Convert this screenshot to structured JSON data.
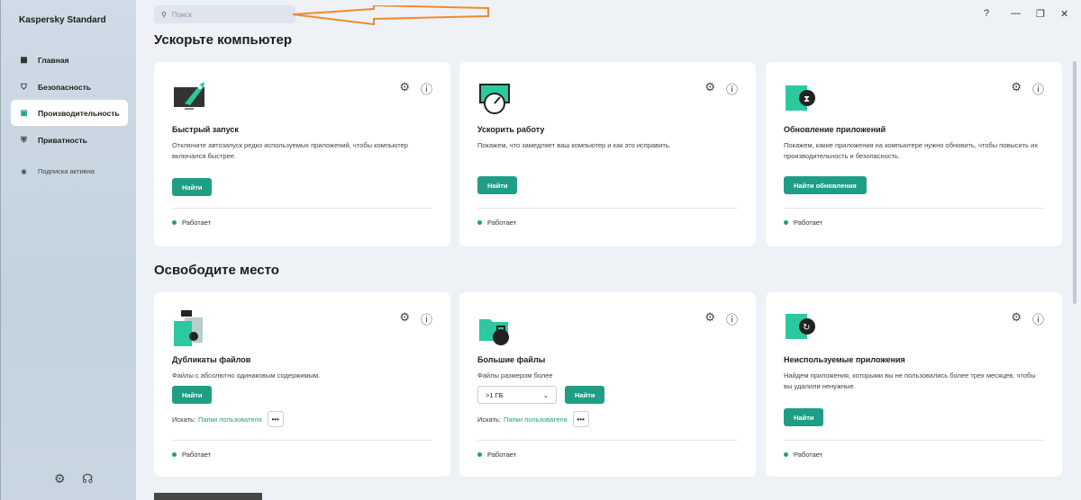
{
  "app": {
    "title": "Kaspersky Standard"
  },
  "sidebar": {
    "items": [
      {
        "label": "Главная"
      },
      {
        "label": "Безопасность"
      },
      {
        "label": "Производительность"
      },
      {
        "label": "Приватность"
      },
      {
        "label": "Подписка активна"
      }
    ]
  },
  "search": {
    "placeholder": "Поиск"
  },
  "window": {
    "help": "?",
    "minimize": "—",
    "restore": "❐",
    "close": "✕"
  },
  "sections": [
    {
      "title": "Ускорьте компьютер",
      "cards": [
        {
          "title": "Быстрый запуск",
          "desc": "Отключите автозапуск редко используемых приложений, чтобы компьютер включался быстрее.",
          "button": "Найти",
          "status": "Работает"
        },
        {
          "title": "Ускорить работу",
          "desc": "Покажем, что замедляет ваш компьютер и как это исправить.",
          "button": "Найти",
          "status": "Работает"
        },
        {
          "title": "Обновление приложений",
          "desc": "Покажем, какие приложения на компьютере нужно обновить, чтобы повысить их производительность и безопасность.",
          "button": "Найти обновления",
          "status": "Работает"
        }
      ]
    },
    {
      "title": "Освободите место",
      "cards": [
        {
          "title": "Дубликаты файлов",
          "desc": "Файлы с абсолютно одинаковым содержимым.",
          "button": "Найти",
          "search_label": "Искать:",
          "search_link": "Папки пользователя",
          "more": "•••",
          "status": "Работает"
        },
        {
          "title": "Большие файлы",
          "desc": "Файлы размером более",
          "select": ">1 ГБ",
          "button": "Найти",
          "search_label": "Искать:",
          "search_link": "Папки пользователя",
          "more": "•••",
          "status": "Работает"
        },
        {
          "title": "Неиспользуемые приложения",
          "desc": "Найдем приложения, которыми вы не пользовались более трех месяцев, чтобы вы удалили ненужные.",
          "button": "Найти",
          "status": "Работает"
        }
      ]
    }
  ]
}
